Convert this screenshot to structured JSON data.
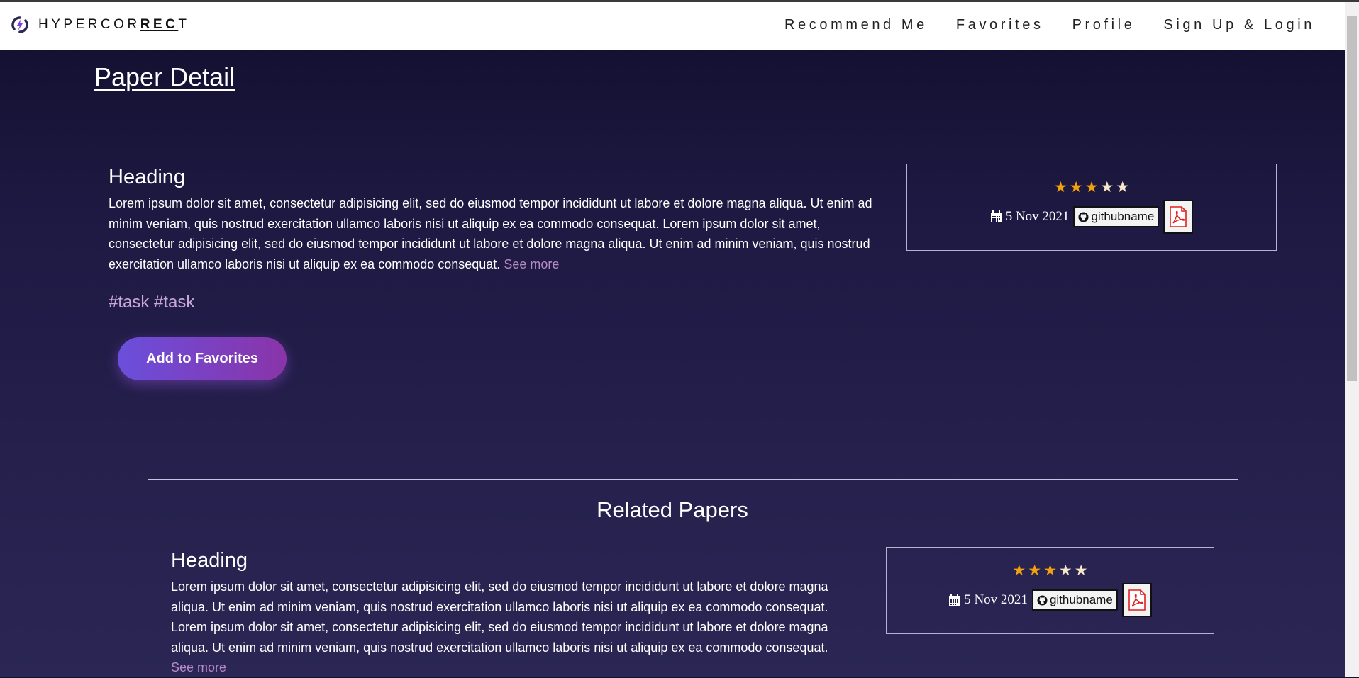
{
  "navbar": {
    "brand_pre": "HYPERCOR",
    "brand_rec": "REC",
    "brand_post": "T",
    "links": [
      "Recommend Me",
      "Favorites",
      "Profile",
      "Sign Up & Login"
    ]
  },
  "page_title": "Paper Detail",
  "paper": {
    "heading": "Heading",
    "text": "Lorem ipsum dolor sit amet, consectetur adipisicing elit, sed do eiusmod tempor incididunt ut labore et dolore magna aliqua. Ut enim ad minim veniam, quis nostrud exercitation ullamco laboris nisi ut aliquip ex ea commodo consequat. Lorem ipsum dolor sit amet, consectetur adipisicing elit, sed do eiusmod tempor incididunt ut labore et dolore magna aliqua. Ut enim ad minim veniam, quis nostrud exercitation ullamco laboris nisi ut aliquip ex ea commodo consequat.",
    "see_more": "See more",
    "tags": "#task #task",
    "rating": 3,
    "rating_max": 5,
    "date": "5 Nov 2021",
    "github": "githubname",
    "add_favorites": "Add to Favorites"
  },
  "related": {
    "title": "Related Papers",
    "items": [
      {
        "heading": "Heading",
        "text": "Lorem ipsum dolor sit amet, consectetur adipisicing elit, sed do eiusmod tempor incididunt ut labore et dolore magna aliqua. Ut enim ad minim veniam, quis nostrud exercitation ullamco laboris nisi ut aliquip ex ea commodo consequat. Lorem ipsum dolor sit amet, consectetur adipisicing elit, sed do eiusmod tempor incididunt ut labore et dolore magna aliqua. Ut enim ad minim veniam, quis nostrud exercitation ullamco laboris nisi ut aliquip ex ea commodo consequat.",
        "see_more": "See more",
        "rating": 3,
        "rating_max": 5,
        "date": "5 Nov 2021",
        "github": "githubname"
      }
    ]
  },
  "colors": {
    "star_on": "#f4a20c",
    "star_off": "#f7e6c8",
    "see_more": "#b78ac8",
    "tag": "#c9a6dc",
    "button_gradient_start": "#6a4fdc",
    "button_gradient_end": "#8a34a8"
  },
  "icons": [
    "logo-icon",
    "calendar-icon",
    "github-icon",
    "pdf-icon",
    "star-icon"
  ]
}
